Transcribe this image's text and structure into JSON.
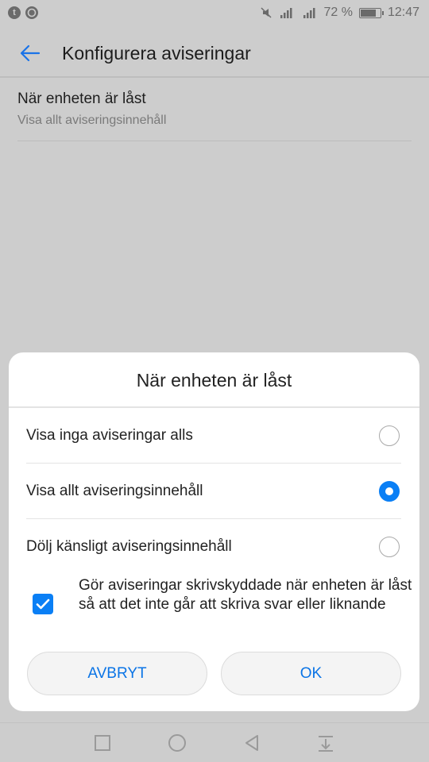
{
  "status_bar": {
    "left_icons": [
      "tumblr-icon",
      "whatsapp-icon"
    ],
    "right_icons": [
      "mute-icon",
      "signal-icon",
      "signal-icon"
    ],
    "battery_text": "72 %",
    "battery_level": 0.72,
    "time": "12:47"
  },
  "app_bar": {
    "back_icon": "back-arrow-icon",
    "title": "Konfigurera aviseringar"
  },
  "setting": {
    "title": "När enheten är låst",
    "subtitle": "Visa allt aviseringsinnehåll"
  },
  "dialog": {
    "title": "När enheten är låst",
    "options": [
      {
        "label": "Visa inga aviseringar alls",
        "selected": false
      },
      {
        "label": "Visa allt aviseringsinnehåll",
        "selected": true
      },
      {
        "label": "Dölj känsligt aviseringsinnehåll",
        "selected": false
      }
    ],
    "checkbox": {
      "label": "Gör aviseringar skrivskyddade när enheten är låst så att det inte går att skriva svar eller liknande",
      "checked": true
    },
    "cancel_label": "AVBRYT",
    "ok_label": "OK"
  },
  "nav_bar": {
    "icons": [
      "recents-square-icon",
      "home-circle-icon",
      "back-triangle-icon",
      "notification-pull-icon"
    ]
  },
  "colors": {
    "accent": "#0a7ff5",
    "scrim_background": "#cdcdcd",
    "dialog_background": "#ffffff"
  }
}
